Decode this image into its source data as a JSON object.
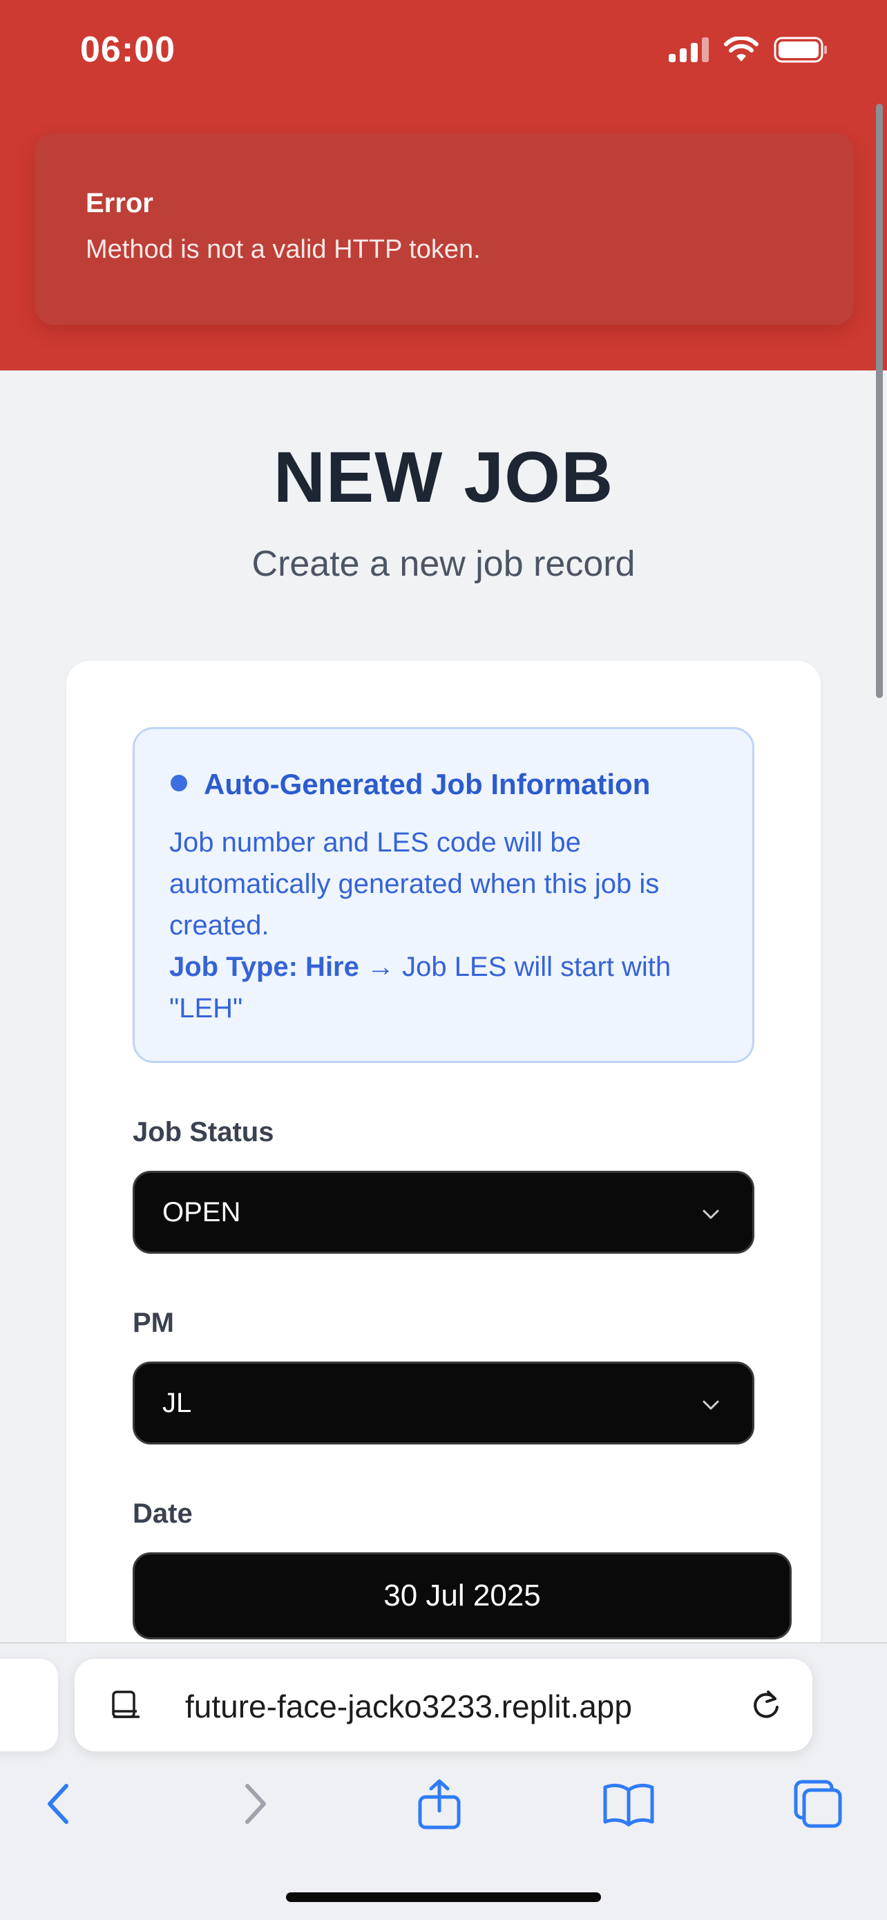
{
  "status_bar": {
    "time": "06:00"
  },
  "toast": {
    "title": "Error",
    "message": "Method is not a valid HTTP token."
  },
  "header": {
    "title": "NEW JOB",
    "subtitle": "Create a new job record"
  },
  "info_box": {
    "heading": "Auto-Generated Job Information",
    "body": "Job number and LES code will be automatically generated when this job is created.",
    "job_type_label": "Job Type: Hire",
    "job_type_note": "→ Job LES will start with \"LEH\""
  },
  "form": {
    "job_status": {
      "label": "Job Status",
      "value": "OPEN"
    },
    "pm": {
      "label": "PM",
      "value": "JL"
    },
    "date": {
      "label": "Date",
      "value": "30 Jul 2025"
    }
  },
  "browser": {
    "url": "future-face-jacko3233.replit.app"
  },
  "colors": {
    "error_red": "#cc3a31",
    "accent_blue": "#2c5bcf",
    "ios_blue": "#2f7bf6"
  },
  "icons": {
    "signal": "cellular-signal-icon",
    "wifi": "wifi-icon",
    "battery": "battery-icon",
    "chevron": "chevron-down-icon",
    "reader": "tab-reader-icon",
    "reload": "reload-icon",
    "back": "back-icon",
    "forward": "forward-icon",
    "share": "share-icon",
    "bookmarks": "bookmarks-icon",
    "tabs": "tabs-icon"
  }
}
